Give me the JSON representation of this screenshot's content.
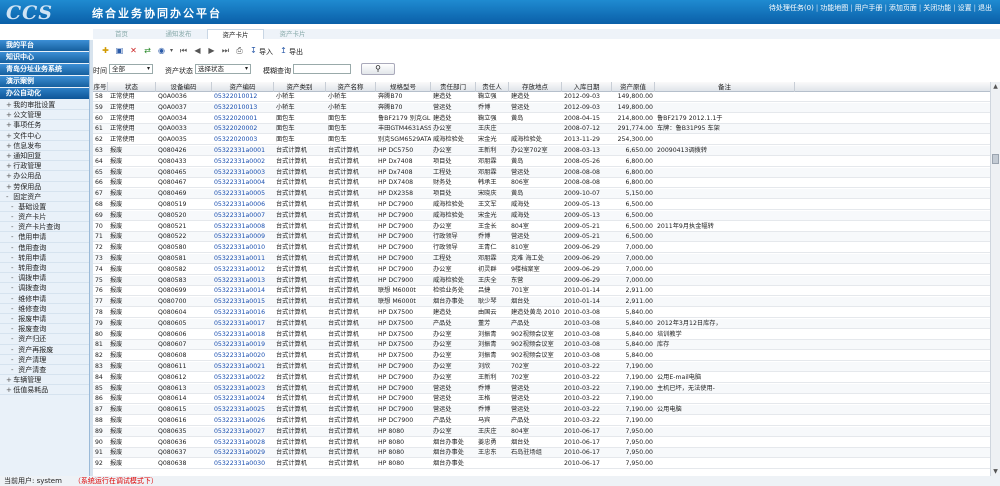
{
  "app": {
    "logo": "CCS",
    "title": "综合业务协同办公平台",
    "links": [
      "待处理任务(0)",
      "功能地图",
      "用户手册",
      "添加页面",
      "关闭功能",
      "设置",
      "退出"
    ]
  },
  "tabs": [
    {
      "label": "首页",
      "active": false
    },
    {
      "label": "通知发布",
      "active": false
    },
    {
      "label": "资产卡片",
      "active": true
    },
    {
      "label": "资产卡片",
      "active": false
    }
  ],
  "sidebar": {
    "sections": [
      {
        "label": "我的平台",
        "type": "head"
      },
      {
        "label": "知识中心",
        "type": "head"
      },
      {
        "label": "青岛分址业务系统",
        "type": "head"
      },
      {
        "label": "演示案例",
        "type": "head"
      },
      {
        "label": "办公自动化",
        "type": "head-plain"
      }
    ],
    "items": [
      {
        "label": "我的审批设置",
        "pm": "+",
        "sub": false
      },
      {
        "label": "公文管理",
        "pm": "+",
        "sub": false
      },
      {
        "label": "事项任务",
        "pm": "+",
        "sub": false
      },
      {
        "label": "文件中心",
        "pm": "+",
        "sub": false
      },
      {
        "label": "信息发布",
        "pm": "+",
        "sub": false
      },
      {
        "label": "通知回复",
        "pm": "+",
        "sub": false
      },
      {
        "label": "行政管理",
        "pm": "+",
        "sub": false
      },
      {
        "label": "办公用品",
        "pm": "+",
        "sub": false
      },
      {
        "label": "劳保用品",
        "pm": "+",
        "sub": false
      },
      {
        "label": "固定资产",
        "pm": "-",
        "sub": false
      },
      {
        "label": "基础设置",
        "pm": "-",
        "sub": true
      },
      {
        "label": "资产卡片",
        "pm": "-",
        "sub": true
      },
      {
        "label": "资产卡片查询",
        "pm": "-",
        "sub": true
      },
      {
        "label": "借用申请",
        "pm": "-",
        "sub": true
      },
      {
        "label": "借用查询",
        "pm": "-",
        "sub": true
      },
      {
        "label": "转用申请",
        "pm": "-",
        "sub": true
      },
      {
        "label": "转用查询",
        "pm": "-",
        "sub": true
      },
      {
        "label": "调拨申请",
        "pm": "-",
        "sub": true
      },
      {
        "label": "调拨查询",
        "pm": "-",
        "sub": true
      },
      {
        "label": "维修申请",
        "pm": "-",
        "sub": true
      },
      {
        "label": "维修查询",
        "pm": "-",
        "sub": true
      },
      {
        "label": "报废申请",
        "pm": "-",
        "sub": true
      },
      {
        "label": "报废查询",
        "pm": "-",
        "sub": true
      },
      {
        "label": "资产归还",
        "pm": "-",
        "sub": true
      },
      {
        "label": "资产再报废",
        "pm": "-",
        "sub": true
      },
      {
        "label": "资产清理",
        "pm": "-",
        "sub": true
      },
      {
        "label": "资产清查",
        "pm": "-",
        "sub": true
      },
      {
        "label": "车辆管理",
        "pm": "+",
        "sub": false
      },
      {
        "label": "低值易耗品",
        "pm": "+",
        "sub": false
      }
    ]
  },
  "toolbar": {
    "import_label": "导入",
    "export_label": "导出"
  },
  "filter": {
    "time_label": "时间",
    "time_value": "全部",
    "status_label": "资产状态",
    "status_value": "选择状态",
    "query_label": "模糊查询",
    "query_value": "",
    "search_icon": "search-icon"
  },
  "table": {
    "columns": [
      "序号",
      "状态",
      "设备编码",
      "资产编码",
      "资产类别",
      "资产名称",
      "规格型号",
      "责任部门",
      "责任人",
      "存放地点",
      "入库日期",
      "资产原值",
      "备注"
    ],
    "rows": [
      [
        "58",
        "正常使用",
        "Q0A0036",
        "05322010012",
        "小轿车",
        "小轿车",
        "奔腾B70",
        "建造处",
        "鞠立强",
        "建造处",
        "2012-09-03",
        "149,800.00",
        ""
      ],
      [
        "59",
        "正常使用",
        "Q0A0037",
        "05322010013",
        "小轿车",
        "小轿车",
        "奔腾B70",
        "营运处",
        "乔博",
        "营运处",
        "2012-09-03",
        "149,800.00",
        ""
      ],
      [
        "60",
        "正常使用",
        "Q0A0034",
        "05322020001",
        "面包车",
        "面包车",
        "鲁BF2179 别克GL",
        "建造处",
        "鞠立强",
        "黄岛",
        "2008-04-15",
        "214,800.00",
        "鲁BF2179  2012.1.1于"
      ],
      [
        "61",
        "正常使用",
        "Q0A0033",
        "05322020002",
        "面包车",
        "面包车",
        "丰田GTM4631ASS",
        "办公室",
        "王庆庄",
        "",
        "2008-07-12",
        "291,774.00",
        "车牌：鲁B31P95  车架"
      ],
      [
        "62",
        "正常使用",
        "Q0A0035",
        "05322020003",
        "面包车",
        "面包车",
        "别克SGM6529ATA",
        "威海检验处",
        "宋金光",
        "威海检验处",
        "2013-11-29",
        "254,300.00",
        ""
      ],
      [
        "63",
        "报废",
        "Q080426",
        "05322331a0001",
        "台式计算机",
        "台式计算机",
        "HP DC5750",
        "办公室",
        "王新利",
        "办公室702室",
        "2008-03-13",
        "6,650.00",
        "20090413调拨转"
      ],
      [
        "64",
        "报废",
        "Q080433",
        "05322331a0002",
        "台式计算机",
        "台式计算机",
        "HP Dx7408",
        "项目处",
        "邓朋霖",
        "黄岛",
        "2008-05-26",
        "6,800.00",
        ""
      ],
      [
        "65",
        "报废",
        "Q080465",
        "05322331a0003",
        "台式计算机",
        "台式计算机",
        "HP Dx7408",
        "工程处",
        "邓朋霖",
        "营运处",
        "2008-08-08",
        "6,800.00",
        ""
      ],
      [
        "66",
        "报废",
        "Q080467",
        "05322331a0004",
        "台式计算机",
        "台式计算机",
        "HP DX7408",
        "财务处",
        "韩承王",
        "806室",
        "2008-08-08",
        "6,800.00",
        ""
      ],
      [
        "67",
        "报废",
        "Q080469",
        "05322331a0005",
        "台式计算机",
        "台式计算机",
        "HP DX2358",
        "项目处",
        "宋晓庆",
        "黄岛",
        "2009-10-07",
        "5,150.00",
        ""
      ],
      [
        "68",
        "报废",
        "Q080519",
        "05322331a0006",
        "台式计算机",
        "台式计算机",
        "HP DC7900",
        "威海检验处",
        "王文军",
        "威海处",
        "2009-05-13",
        "6,500.00",
        ""
      ],
      [
        "69",
        "报废",
        "Q080520",
        "05322331a0007",
        "台式计算机",
        "台式计算机",
        "HP DC7900",
        "威海检验处",
        "宋金光",
        "威海处",
        "2009-05-13",
        "6,500.00",
        ""
      ],
      [
        "70",
        "报废",
        "Q080521",
        "05322331a0008",
        "台式计算机",
        "台式计算机",
        "HP DC7900",
        "办公室",
        "王金长",
        "804室",
        "2009-05-21",
        "6,500.00",
        "2011年9月执金辐转"
      ],
      [
        "71",
        "报废",
        "Q080522",
        "05322331a0009",
        "台式计算机",
        "台式计算机",
        "HP DC7900",
        "行政领导",
        "乔博",
        "营运处",
        "2009-05-21",
        "6,500.00",
        ""
      ],
      [
        "72",
        "报废",
        "Q080580",
        "05322331a0010",
        "台式计算机",
        "台式计算机",
        "HP DC7900",
        "行政领导",
        "王青仁",
        "810室",
        "2009-06-29",
        "7,000.00",
        ""
      ],
      [
        "73",
        "报废",
        "Q080581",
        "05322331a0011",
        "台式计算机",
        "台式计算机",
        "HP DC7900",
        "工程处",
        "邓朋霖",
        "克难 海工处",
        "2009-06-29",
        "7,000.00",
        ""
      ],
      [
        "74",
        "报废",
        "Q080582",
        "05322331a0012",
        "台式计算机",
        "台式计算机",
        "HP DC7900",
        "办公室",
        "初灵群",
        "9楼档案室",
        "2009-06-29",
        "7,000.00",
        ""
      ],
      [
        "75",
        "报废",
        "Q080583",
        "05322331a0013",
        "台式计算机",
        "台式计算机",
        "HP DC7900",
        "威海检验处",
        "王庆全",
        "东营",
        "2009-06-29",
        "7,000.00",
        ""
      ],
      [
        "76",
        "报废",
        "Q080699",
        "05322331a0014",
        "台式计算机",
        "台式计算机",
        "联想 M6000t",
        "检验业务处",
        "吕捷",
        "701室",
        "2010-01-14",
        "2,911.00",
        ""
      ],
      [
        "77",
        "报废",
        "Q080700",
        "05322331a0015",
        "台式计算机",
        "台式计算机",
        "联想 M6000t",
        "烟台办事处",
        "耿少琴",
        "烟台处",
        "2010-01-14",
        "2,911.00",
        ""
      ],
      [
        "78",
        "报废",
        "Q080604",
        "05322331a0016",
        "台式计算机",
        "台式计算机",
        "HP DX7500",
        "建造处",
        "由国云",
        "建造处黄岛 2010",
        "2010-03-08",
        "5,840.00",
        ""
      ],
      [
        "79",
        "报废",
        "Q080605",
        "05322331a0017",
        "台式计算机",
        "台式计算机",
        "HP DX7500",
        "产品处",
        "董芳",
        "产品处",
        "2010-03-08",
        "5,840.00",
        "2012年3月12日库存，"
      ],
      [
        "80",
        "报废",
        "Q080606",
        "05322331a0018",
        "台式计算机",
        "台式计算机",
        "HP DX7500",
        "办公室",
        "刘振青",
        "902视频会议室",
        "2010-03-08",
        "5,840.00",
        "培训教学"
      ],
      [
        "81",
        "报废",
        "Q080607",
        "05322331a0019",
        "台式计算机",
        "台式计算机",
        "HP DX7500",
        "办公室",
        "刘振青",
        "902视频会议室",
        "2010-03-08",
        "5,840.00",
        "库存"
      ],
      [
        "82",
        "报废",
        "Q080608",
        "05322331a0020",
        "台式计算机",
        "台式计算机",
        "HP DX7500",
        "办公室",
        "刘振青",
        "902视频会议室",
        "2010-03-08",
        "5,840.00",
        ""
      ],
      [
        "83",
        "报废",
        "Q080611",
        "05322331a0021",
        "台式计算机",
        "台式计算机",
        "HP DC7900",
        "办公室",
        "刘欣",
        "702室",
        "2010-03-22",
        "7,190.00",
        ""
      ],
      [
        "84",
        "报废",
        "Q080612",
        "05322331a0022",
        "台式计算机",
        "台式计算机",
        "HP DC7900",
        "办公室",
        "王新利",
        "702室",
        "2010-03-22",
        "7,190.00",
        "公用E-mail电脑"
      ],
      [
        "85",
        "报废",
        "Q080613",
        "05322331a0023",
        "台式计算机",
        "台式计算机",
        "HP DC7900",
        "营运处",
        "乔博",
        "营运处",
        "2010-03-22",
        "7,190.00",
        "主机已坏，无法使用-"
      ],
      [
        "86",
        "报废",
        "Q080614",
        "05322331a0024",
        "台式计算机",
        "台式计算机",
        "HP DC7900",
        "营运处",
        "王格",
        "营运处",
        "2010-03-22",
        "7,190.00",
        ""
      ],
      [
        "87",
        "报废",
        "Q080615",
        "05322331a0025",
        "台式计算机",
        "台式计算机",
        "HP DC7900",
        "营运处",
        "乔博",
        "营运处",
        "2010-03-22",
        "7,190.00",
        "公用电脑"
      ],
      [
        "88",
        "报废",
        "Q080616",
        "05322331a0026",
        "台式计算机",
        "台式计算机",
        "HP DC7900",
        "产品处",
        "马宾",
        "产品处",
        "2010-03-22",
        "7,190.00",
        ""
      ],
      [
        "89",
        "报废",
        "Q080635",
        "05322331a0027",
        "台式计算机",
        "台式计算机",
        "HP 8080",
        "办公室",
        "王庆庄",
        "804室",
        "2010-06-17",
        "7,950.00",
        ""
      ],
      [
        "90",
        "报废",
        "Q080636",
        "05322331a0028",
        "台式计算机",
        "台式计算机",
        "HP 8080",
        "烟台办事处",
        "姜忠勇",
        "烟台处",
        "2010-06-17",
        "7,950.00",
        ""
      ],
      [
        "91",
        "报废",
        "Q080637",
        "05322331a0029",
        "台式计算机",
        "台式计算机",
        "HP 8080",
        "烟台办事处",
        "王忠东",
        "石岛驻场组",
        "2010-06-17",
        "7,950.00",
        ""
      ],
      [
        "92",
        "报废",
        "Q080638",
        "05322331a0030",
        "台式计算机",
        "台式计算机",
        "HP 8080",
        "烟台办事处",
        "",
        "",
        "2010-06-17",
        "7,950.00",
        ""
      ]
    ]
  },
  "status": {
    "user_label": "当前用户: system",
    "warning": "（系统运行在调试模式下）"
  }
}
